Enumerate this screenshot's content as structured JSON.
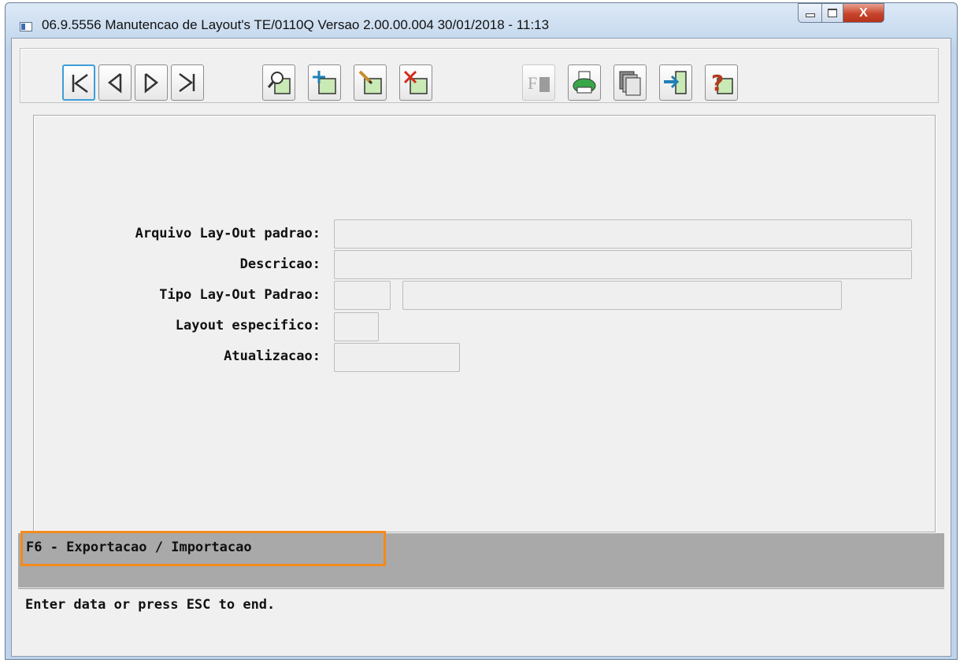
{
  "window": {
    "title": "06.9.5556 Manutencao  de Layout's TE/0110Q Versao 2.00.00.004 30/01/2018 - 11:13",
    "close_glyph": "X"
  },
  "toolbar": {
    "buttons": [
      {
        "name": "first-record",
        "icon": "first-icon"
      },
      {
        "name": "previous-record",
        "icon": "previous-icon"
      },
      {
        "name": "next-record",
        "icon": "next-icon"
      },
      {
        "name": "last-record",
        "icon": "last-icon"
      },
      {
        "name": "search",
        "icon": "search-icon"
      },
      {
        "name": "add",
        "icon": "add-icon"
      },
      {
        "name": "edit",
        "icon": "edit-icon"
      },
      {
        "name": "delete",
        "icon": "delete-icon"
      },
      {
        "name": "filter",
        "icon": "filter-icon",
        "disabled": true
      },
      {
        "name": "print",
        "icon": "print-icon"
      },
      {
        "name": "copy",
        "icon": "copy-icon"
      },
      {
        "name": "exit",
        "icon": "exit-icon"
      },
      {
        "name": "help",
        "icon": "help-icon"
      }
    ]
  },
  "form": {
    "arquivo_label": "Arquivo Lay-Out padrao:",
    "arquivo_value": "",
    "descricao_label": "Descricao:",
    "descricao_value": "",
    "tipo_label": "Tipo Lay-Out Padrao:",
    "tipo_code_value": "",
    "tipo_desc_value": "",
    "layout_label": "Layout especifico:",
    "layout_value": "",
    "atualizacao_label": "Atualizacao:",
    "atualizacao_value": ""
  },
  "fkeys": {
    "text": "F6 - Exportacao / Importacao"
  },
  "status": {
    "text": "Enter data or press ESC to end."
  },
  "colors": {
    "highlight": "#f48a1c",
    "fkey_bar": "#a9a9a9",
    "active_button_border": "#3c9ed8",
    "window_frame": "#bfd3ea"
  }
}
